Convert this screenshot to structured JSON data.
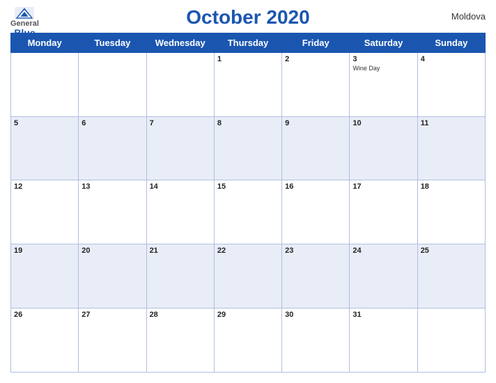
{
  "header": {
    "logo_general": "General",
    "logo_blue": "Blue",
    "title": "October 2020",
    "country": "Moldova"
  },
  "weekdays": [
    "Monday",
    "Tuesday",
    "Wednesday",
    "Thursday",
    "Friday",
    "Saturday",
    "Sunday"
  ],
  "weeks": [
    [
      {
        "day": "",
        "empty": true
      },
      {
        "day": "",
        "empty": true
      },
      {
        "day": "",
        "empty": true
      },
      {
        "day": "1",
        "holiday": ""
      },
      {
        "day": "2",
        "holiday": ""
      },
      {
        "day": "3",
        "holiday": "Wine Day"
      },
      {
        "day": "4",
        "holiday": ""
      }
    ],
    [
      {
        "day": "5",
        "holiday": ""
      },
      {
        "day": "6",
        "holiday": ""
      },
      {
        "day": "7",
        "holiday": ""
      },
      {
        "day": "8",
        "holiday": ""
      },
      {
        "day": "9",
        "holiday": ""
      },
      {
        "day": "10",
        "holiday": ""
      },
      {
        "day": "11",
        "holiday": ""
      }
    ],
    [
      {
        "day": "12",
        "holiday": ""
      },
      {
        "day": "13",
        "holiday": ""
      },
      {
        "day": "14",
        "holiday": ""
      },
      {
        "day": "15",
        "holiday": ""
      },
      {
        "day": "16",
        "holiday": ""
      },
      {
        "day": "17",
        "holiday": ""
      },
      {
        "day": "18",
        "holiday": ""
      }
    ],
    [
      {
        "day": "19",
        "holiday": ""
      },
      {
        "day": "20",
        "holiday": ""
      },
      {
        "day": "21",
        "holiday": ""
      },
      {
        "day": "22",
        "holiday": ""
      },
      {
        "day": "23",
        "holiday": ""
      },
      {
        "day": "24",
        "holiday": ""
      },
      {
        "day": "25",
        "holiday": ""
      }
    ],
    [
      {
        "day": "26",
        "holiday": ""
      },
      {
        "day": "27",
        "holiday": ""
      },
      {
        "day": "28",
        "holiday": ""
      },
      {
        "day": "29",
        "holiday": ""
      },
      {
        "day": "30",
        "holiday": ""
      },
      {
        "day": "31",
        "holiday": ""
      },
      {
        "day": "",
        "empty": true
      }
    ]
  ]
}
